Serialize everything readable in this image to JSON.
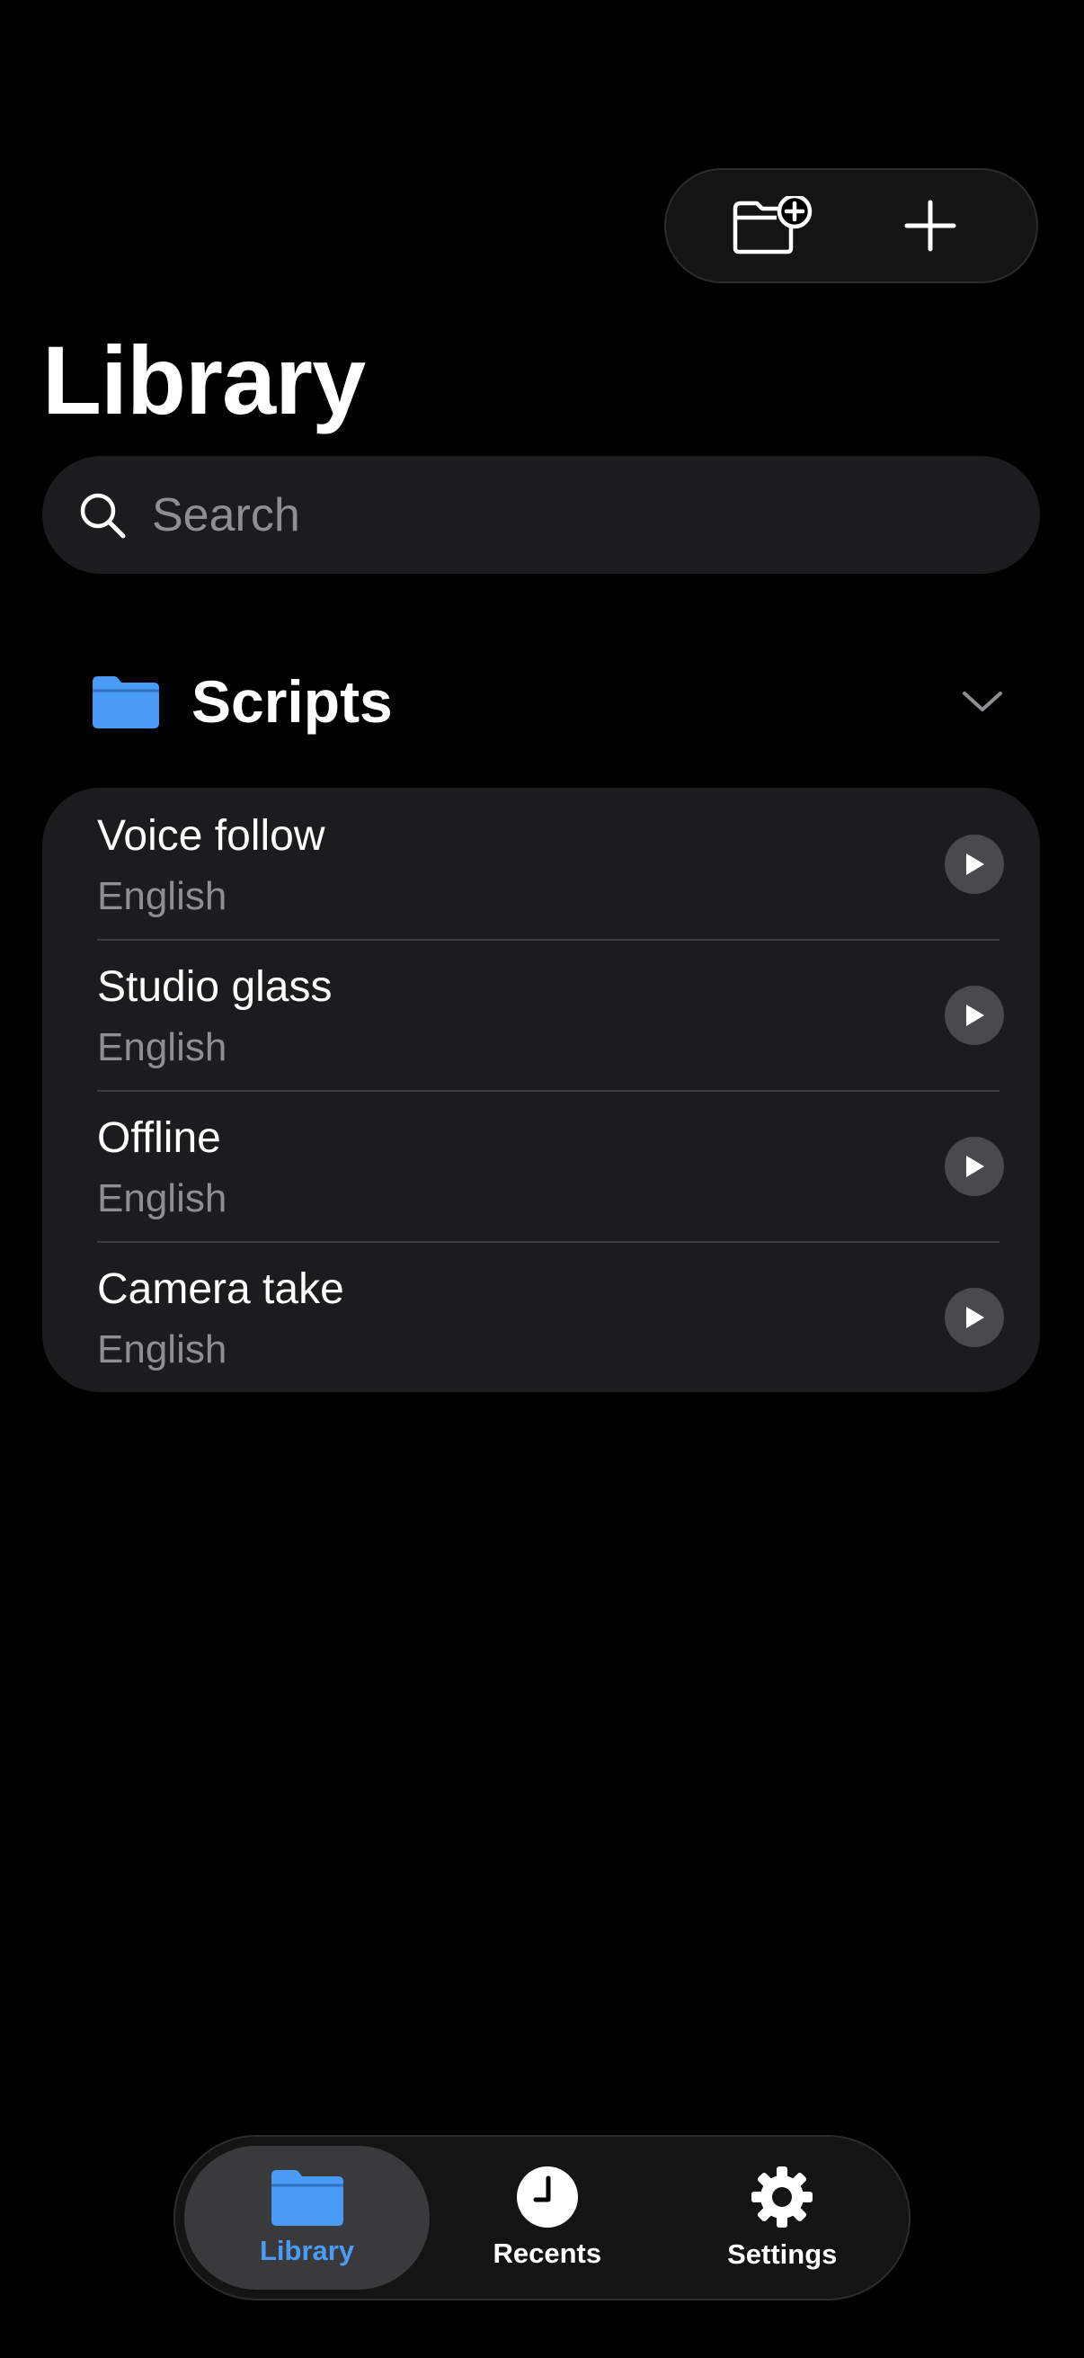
{
  "header": {
    "title": "Library",
    "actions": [
      {
        "icon": "folder-add-icon"
      },
      {
        "icon": "plus-icon"
      }
    ]
  },
  "search": {
    "placeholder": "Search",
    "value": ""
  },
  "folder": {
    "name": "Scripts",
    "icon": "folder-icon",
    "expanded": true,
    "color": "#4a9bf5"
  },
  "scripts": [
    {
      "name": "Voice follow",
      "language": "English"
    },
    {
      "name": "Studio glass",
      "language": "English"
    },
    {
      "name": "Offline",
      "language": "English"
    },
    {
      "name": "Camera take",
      "language": "English"
    }
  ],
  "tab_bar": {
    "selected": "Library",
    "tabs": [
      {
        "label": "Library",
        "icon": "folder-icon"
      },
      {
        "label": "Recents",
        "icon": "clock-icon"
      },
      {
        "label": "Settings",
        "icon": "gear-icon"
      }
    ]
  },
  "colors": {
    "accent": "#4a9bf5",
    "background": "#000000",
    "card": "#1c1c1e",
    "secondary_text": "#8e8e93"
  }
}
